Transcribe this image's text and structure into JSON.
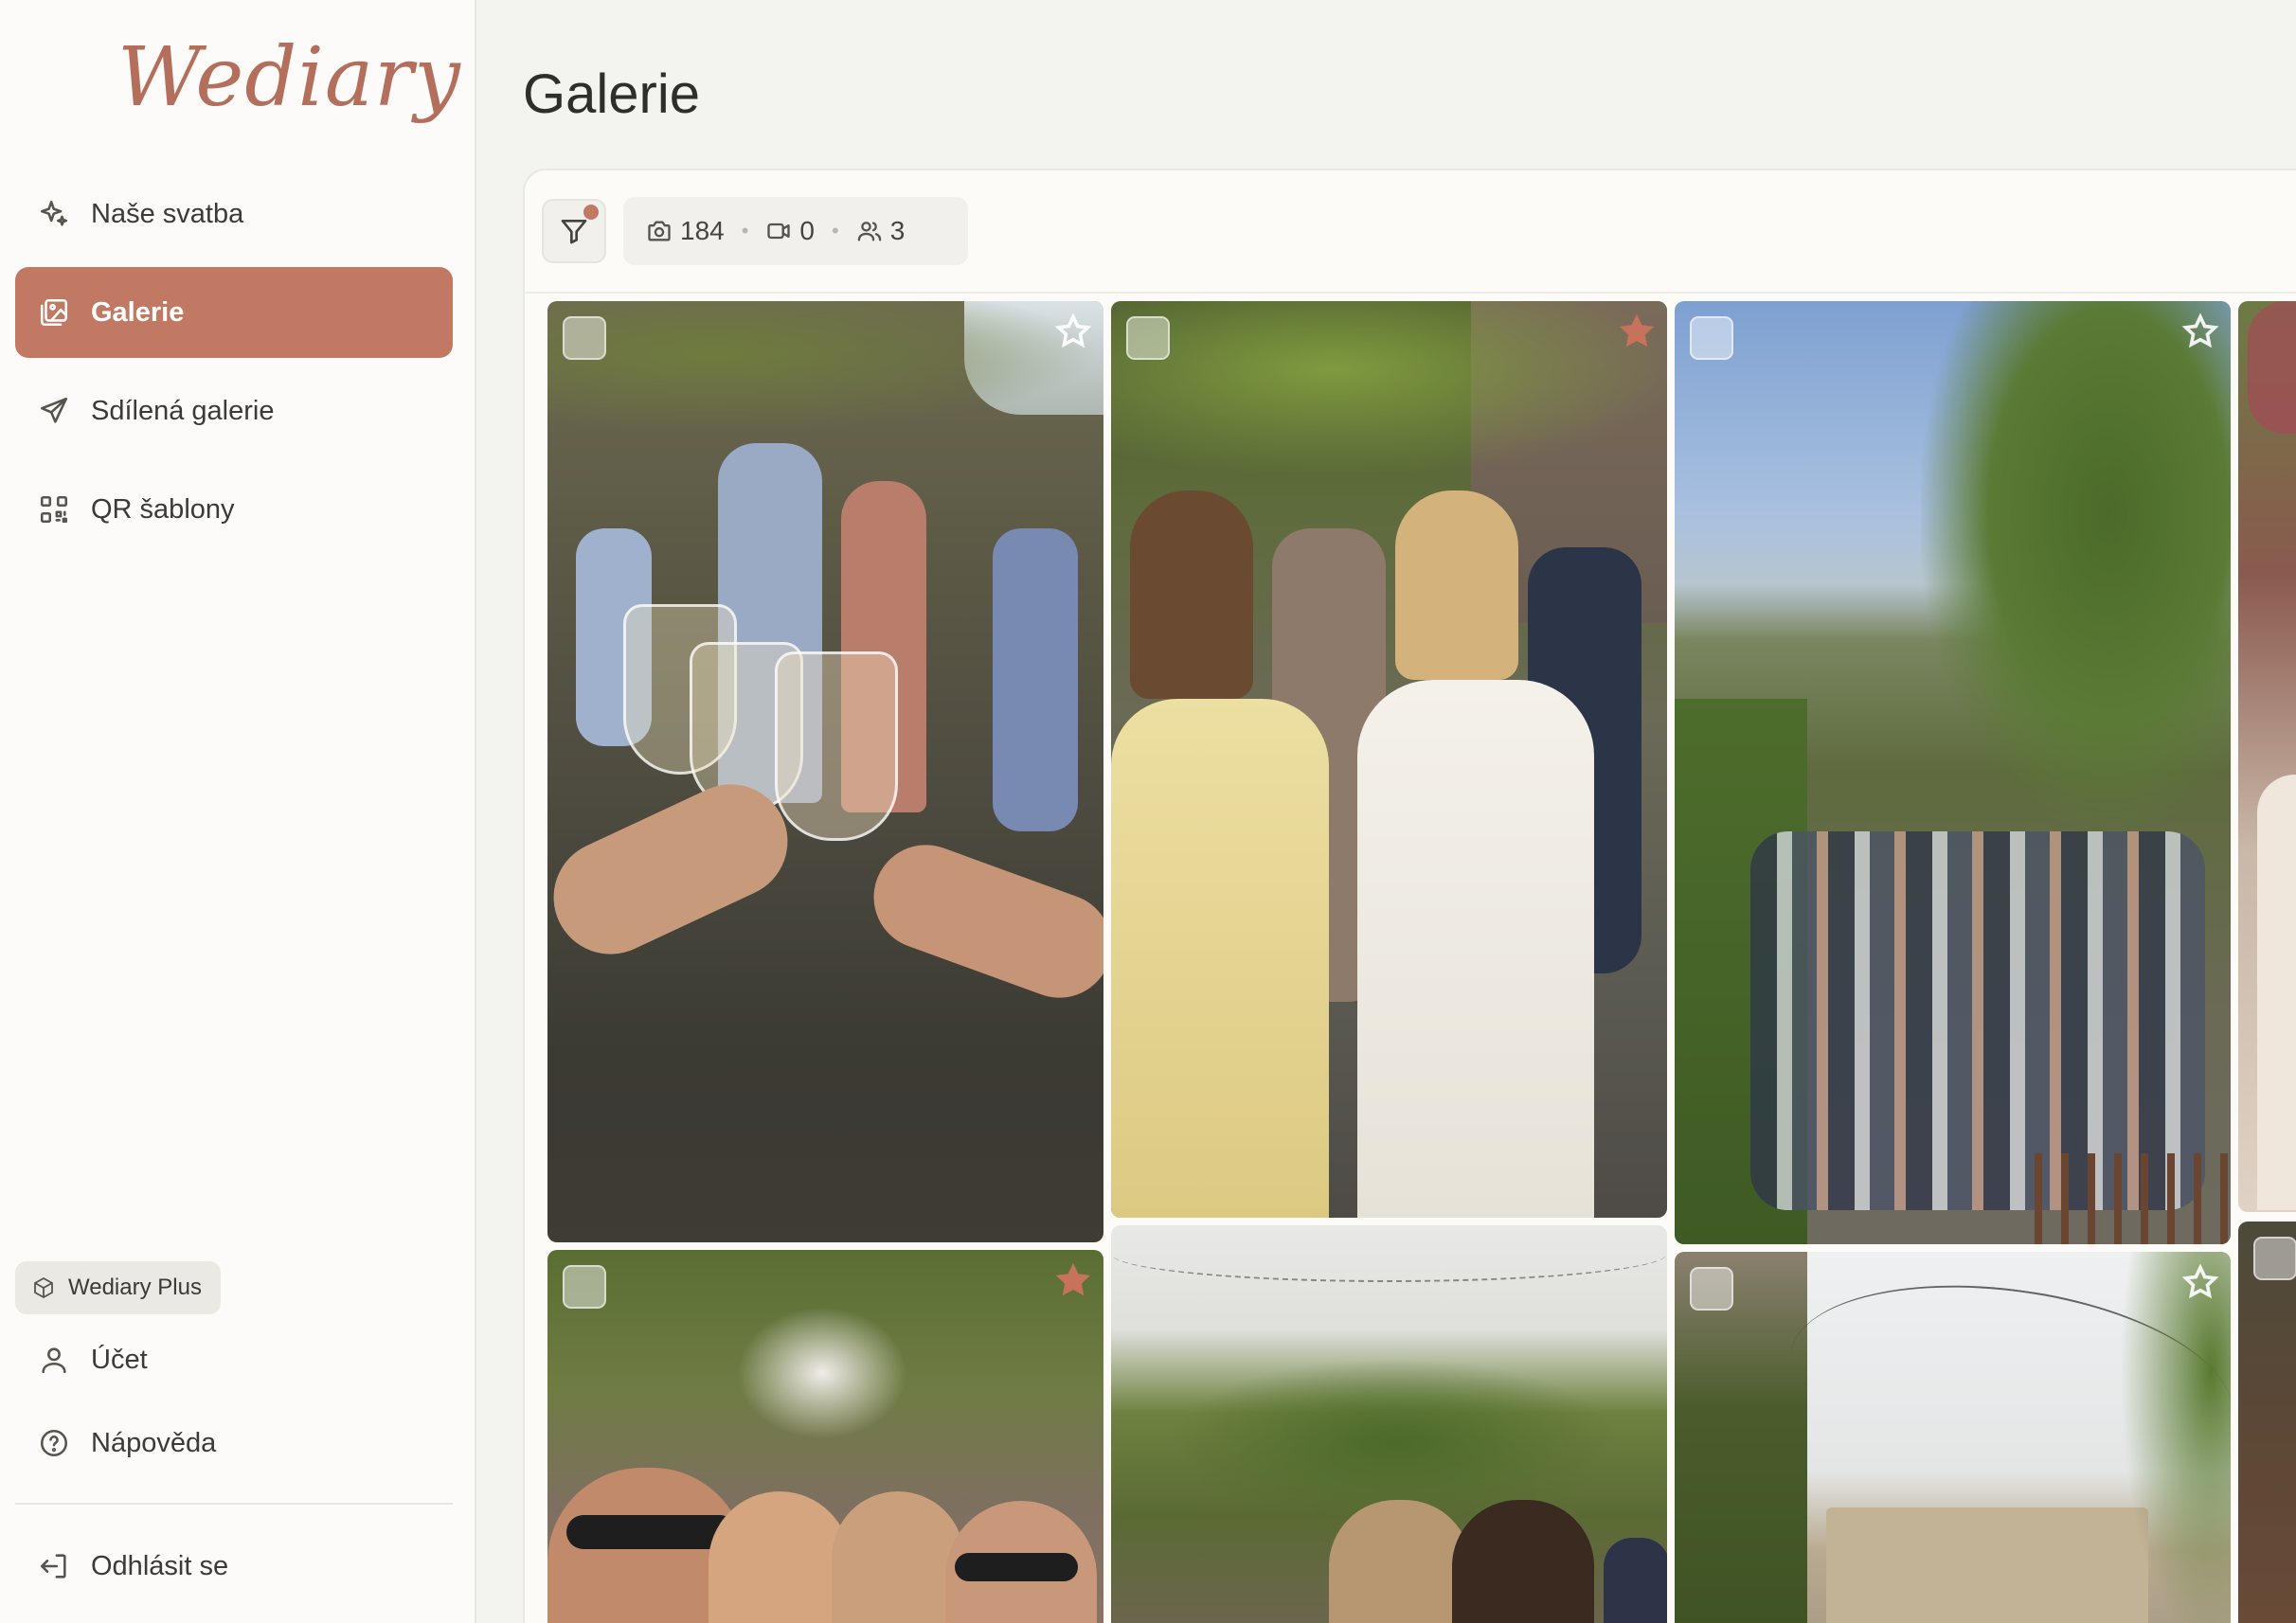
{
  "app": {
    "logo_text": "Wediary",
    "brand_color": "#c17964"
  },
  "sidebar": {
    "items": [
      {
        "label": "Naše svatba",
        "icon": "sparkles-icon",
        "active": false
      },
      {
        "label": "Galerie",
        "icon": "gallery-icon",
        "active": true
      },
      {
        "label": "Sdílená galerie",
        "icon": "send-icon",
        "active": false
      },
      {
        "label": "QR šablony",
        "icon": "qr-code-icon",
        "active": false
      }
    ],
    "plan_badge": "Wediary Plus",
    "footer_items": [
      {
        "label": "Účet",
        "icon": "user-icon"
      },
      {
        "label": "Nápověda",
        "icon": "help-icon"
      },
      {
        "label": "Odhlásit se",
        "icon": "logout-icon"
      }
    ]
  },
  "main": {
    "title": "Galerie",
    "toolbar": {
      "filter_active": true,
      "photos_count": "184",
      "videos_count": "0",
      "guests_count": "3"
    },
    "photos": [
      {
        "description": "toast with wine glasses",
        "favorite": false
      },
      {
        "description": "bride and guest in yellow dress",
        "favorite": true
      },
      {
        "description": "guests on terrace with valley view",
        "favorite": false
      },
      {
        "description": "partial photo",
        "favorite": false
      },
      {
        "description": "group selfie with sunglasses",
        "favorite": true
      },
      {
        "description": "guests under string lights",
        "favorite": false
      },
      {
        "description": "stone house with string lights",
        "favorite": false
      },
      {
        "description": "partial photo",
        "favorite": false
      }
    ]
  }
}
